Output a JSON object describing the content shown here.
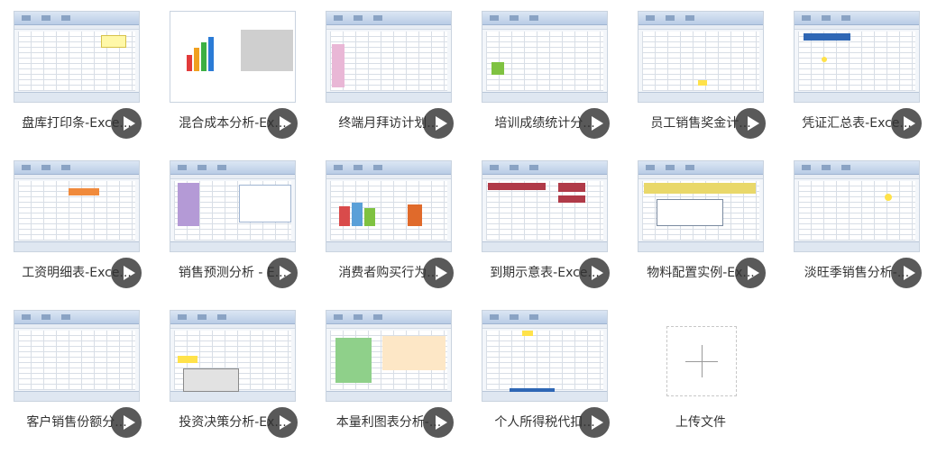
{
  "files": [
    {
      "label": "盘库打印条-Exce..."
    },
    {
      "label": "混合成本分析-Ex..."
    },
    {
      "label": "终端月拜访计划..."
    },
    {
      "label": "培训成绩统计分..."
    },
    {
      "label": "员工销售奖金计..."
    },
    {
      "label": "凭证汇总表-Exce..."
    },
    {
      "label": "工资明细表-Exce..."
    },
    {
      "label": "销售预测分析 - E..."
    },
    {
      "label": "消费者购买行为..."
    },
    {
      "label": "到期示意表-Exce..."
    },
    {
      "label": "物料配置实例-Ex..."
    },
    {
      "label": "淡旺季销售分析-..."
    },
    {
      "label": "客户销售份额分..."
    },
    {
      "label": "投资决策分析-Ex..."
    },
    {
      "label": "本量利图表分析-..."
    },
    {
      "label": "个人所得税代扣..."
    }
  ],
  "upload": {
    "label": "上传文件"
  },
  "colors": {
    "play_bg": "#3c3c3c",
    "text": "#333333",
    "excel_ribbon": "#b9cce6"
  }
}
